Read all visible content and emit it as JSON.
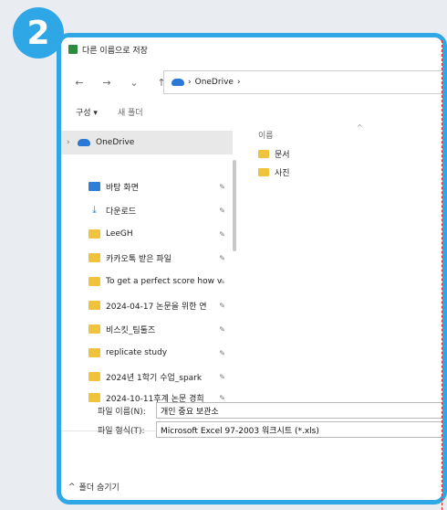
{
  "badge": "2",
  "window": {
    "title": "다른 이름으로 저장"
  },
  "nav": {
    "back": "←",
    "forward": "→",
    "recent": "⌄",
    "up": "↑"
  },
  "address": {
    "location": "OneDrive",
    "separator": "›",
    "trail": "›"
  },
  "toolbar": {
    "organize": "구성 ▾",
    "new_folder": "새 폴더"
  },
  "sidebar": {
    "onedrive": "OneDrive",
    "expand_glyph": "›",
    "pin_glyph": "✎",
    "items": [
      {
        "label": "바탕 화면",
        "icon": "desktop-icon"
      },
      {
        "label": "다운로드",
        "icon": "download-icon"
      },
      {
        "label": "LeeGH",
        "icon": "folder-icon"
      },
      {
        "label": "카카오톡 받은 파일",
        "icon": "folder-icon"
      },
      {
        "label": "To get a perfect score how v",
        "icon": "folder-icon"
      },
      {
        "label": "2024-04-17 논문을 위한 연",
        "icon": "folder-icon"
      },
      {
        "label": "비스킷_팀툴즈",
        "icon": "folder-icon"
      },
      {
        "label": "replicate study",
        "icon": "folder-icon"
      },
      {
        "label": "2024년 1학기 수업_spark",
        "icon": "folder-icon"
      },
      {
        "label": "2024-10-11후계 논문 경희",
        "icon": "folder-icon"
      }
    ]
  },
  "content": {
    "column_name": "이름",
    "sort_caret": "^",
    "files": [
      {
        "name": "문서"
      },
      {
        "name": "사진"
      }
    ]
  },
  "form": {
    "filename_label": "파일 이름(N):",
    "filename_value": "개인 중요 보관소",
    "filetype_label": "파일 형식(T):",
    "filetype_value": "Microsoft Excel 97-2003 워크시트 (*.xls)"
  },
  "footer": {
    "toggle_glyph": "^",
    "hide_folders": "폴더 숨기기"
  }
}
